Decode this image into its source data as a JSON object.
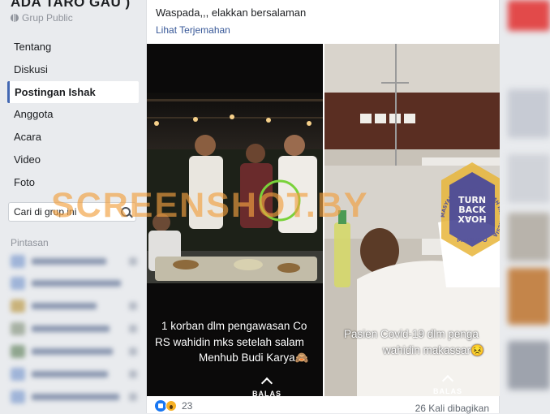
{
  "sidebar": {
    "group_name": "ADA TARO GAU )",
    "group_type": "Grup Public",
    "items": [
      {
        "label": "Tentang",
        "active": false
      },
      {
        "label": "Diskusi",
        "active": false
      },
      {
        "label": "Postingan Ishak",
        "active": true
      },
      {
        "label": "Anggota",
        "active": false
      },
      {
        "label": "Acara",
        "active": false
      },
      {
        "label": "Video",
        "active": false
      },
      {
        "label": "Foto",
        "active": false
      }
    ],
    "search_placeholder": "Cari di grup ini",
    "shortcuts_label": "Pintasan"
  },
  "post": {
    "text": "Waspada,,, elakkan bersalaman",
    "translate_link": "Lihat Terjemahan",
    "photo_left": {
      "caption_line1": "1 korban dlm pengawasan Co",
      "caption_line2": "RS wahidin mks setelah salam",
      "caption_line3": "Menhub Budi Karya🙈",
      "reply_label": "BALAS"
    },
    "photo_right": {
      "caption_line1": "Pasien Covid-19 dlm penga",
      "caption_line2": "wahidin makassar😣",
      "reply_label": "BALAS"
    },
    "watermark": "SCREENSHOT.BY",
    "badge": {
      "ring_text": "MASYARAKAT ANTI FITNAH INDONESIA",
      "top_text": "TURN",
      "middle_text": "BACK",
      "bottom_text": "HOAX",
      "footer_text": "MAFINDO"
    },
    "reaction_count": "23",
    "share_count": "26 Kali dibagikan"
  },
  "colors": {
    "accent": "#4267b2",
    "link": "#385898",
    "page_bg": "#e9ebee",
    "watermark": "#f2a040",
    "badge": "#e8b63a"
  }
}
